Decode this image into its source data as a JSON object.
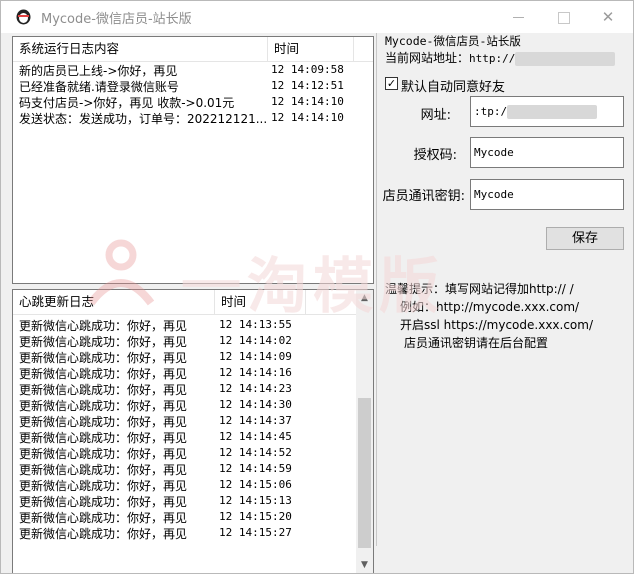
{
  "window": {
    "title": "Mycode-微信店员-站长版",
    "minimize_label": "",
    "close_label": "✕"
  },
  "log_list": {
    "columns": [
      "系统运行日志内容",
      "时间"
    ],
    "rows": [
      {
        "content": "新的店员已上线->你好，再见",
        "time": "12 14:09:58"
      },
      {
        "content": "已经准备就绪.请登录微信账号",
        "time": "12 14:12:51"
      },
      {
        "content": "码支付店员->你好，再见 收款->0.01元",
        "time": "12 14:14:10"
      },
      {
        "content": "发送状态：发送成功，订单号：202212121...",
        "time": "12 14:14:10"
      }
    ]
  },
  "heartbeat_list": {
    "columns": [
      "心跳更新日志",
      "时间"
    ],
    "rows": [
      {
        "content": "更新微信心跳成功：你好，再见",
        "time": "12 14:13:55"
      },
      {
        "content": "更新微信心跳成功：你好，再见",
        "time": "12 14:14:02"
      },
      {
        "content": "更新微信心跳成功：你好，再见",
        "time": "12 14:14:09"
      },
      {
        "content": "更新微信心跳成功：你好，再见",
        "time": "12 14:14:16"
      },
      {
        "content": "更新微信心跳成功：你好，再见",
        "time": "12 14:14:23"
      },
      {
        "content": "更新微信心跳成功：你好，再见",
        "time": "12 14:14:30"
      },
      {
        "content": "更新微信心跳成功：你好，再见",
        "time": "12 14:14:37"
      },
      {
        "content": "更新微信心跳成功：你好，再见",
        "time": "12 14:14:45"
      },
      {
        "content": "更新微信心跳成功：你好，再见",
        "time": "12 14:14:52"
      },
      {
        "content": "更新微信心跳成功：你好，再见",
        "time": "12 14:14:59"
      },
      {
        "content": "更新微信心跳成功：你好，再见",
        "time": "12 14:15:06"
      },
      {
        "content": "更新微信心跳成功：你好，再见",
        "time": "12 14:15:13"
      },
      {
        "content": "更新微信心跳成功：你好，再见",
        "time": "12 14:15:20"
      },
      {
        "content": "更新微信心跳成功：你好，再见",
        "time": "12 14:15:27"
      }
    ]
  },
  "right_panel": {
    "app_name": "Mycode-微信店员-站长版",
    "site_label": "当前网站地址：",
    "site_value": "http://",
    "auto_accept_label": "默认自动同意好友",
    "auto_accept_checked": "✓",
    "url_label": "网址:",
    "url_value": ":tp:/",
    "auth_label": "授权码:",
    "auth_value": "Mycode",
    "secret_label": "店员通讯密钥:",
    "secret_value": "Mycode",
    "save_label": "保存",
    "tip_line1": "温馨提示：填写网站记得加http:// /",
    "tip_line2": "例如：http://mycode.xxx.com/",
    "tip_line3": "开启ssl https://mycode.xxx.com/",
    "tip_line4": "店员通讯密钥请在后台配置"
  },
  "watermark": {
    "text": "一淘模版"
  },
  "colors": {
    "window_bg": "#f0f0f0",
    "list_bg": "#ffffff",
    "border": "#7a7a7a",
    "watermark": "#e8a0a0"
  },
  "icons": [
    "app-icon",
    "minimize-icon",
    "maximize-icon",
    "close-icon",
    "check-icon",
    "scroll-up-arrow-icon",
    "scroll-down-arrow-icon"
  ]
}
